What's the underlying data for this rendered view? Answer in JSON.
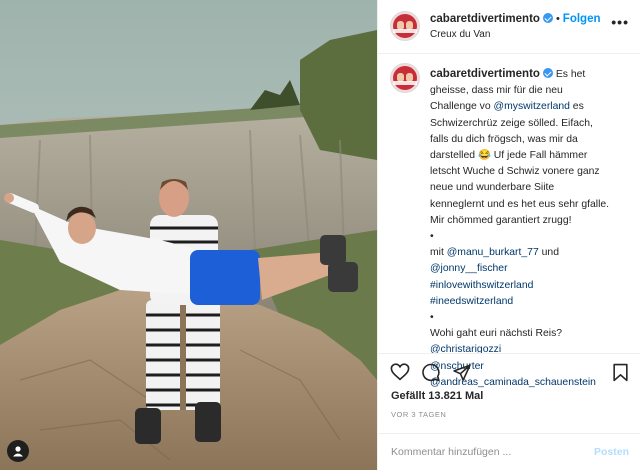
{
  "post": {
    "username": "cabaretdivertimento",
    "separator": "•",
    "follow_label": "Folgen",
    "location": "Creux du Van",
    "more_label": "•••"
  },
  "caption": {
    "username": "cabaretdivertimento",
    "lines": [
      {
        "pre": "Es het",
        "tag": "",
        "post": ""
      },
      {
        "pre": "gheisse, dass mir für die neu",
        "tag": "",
        "post": ""
      },
      {
        "pre": "Challenge vo ",
        "tag": "@myswitzerland",
        "post": " es"
      },
      {
        "pre": "Schwizerchrüz zeige sölled. Eifach,",
        "tag": "",
        "post": ""
      },
      {
        "pre": "falls du dich frögsch, was mir da",
        "tag": "",
        "post": ""
      },
      {
        "pre": "darstelled 😂 Uf jede Fall hämmer",
        "tag": "",
        "post": ""
      },
      {
        "pre": "letscht Wuche d Schwiz vonere ganz",
        "tag": "",
        "post": ""
      },
      {
        "pre": "neue und wunderbare Siite",
        "tag": "",
        "post": ""
      },
      {
        "pre": "kenneglernt und es het eus sehr gfalle.",
        "tag": "",
        "post": ""
      },
      {
        "pre": "Mir chömmed garantiert zrugg!",
        "tag": "",
        "post": ""
      },
      {
        "pre": "•",
        "tag": "",
        "post": ""
      },
      {
        "pre": "mit ",
        "tag": "@manu_burkart_77",
        "post": " und"
      },
      {
        "pre": "",
        "tag": "@jonny__fischer",
        "post": ""
      },
      {
        "pre": "",
        "tag": "#inlovewithswitzerland",
        "post": ""
      },
      {
        "pre": "",
        "tag": "#ineedswitzerland",
        "post": ""
      },
      {
        "pre": "•",
        "tag": "",
        "post": ""
      },
      {
        "pre": "Wohi gaht euri nächsti Reis?",
        "tag": "",
        "post": ""
      },
      {
        "pre": "",
        "tag": "@christarigozzi",
        "post": ""
      },
      {
        "pre": "",
        "tag": "@nschurter",
        "post": ""
      },
      {
        "pre": "",
        "tag": "@andreas_caminada_schauenstein",
        "post": ""
      }
    ]
  },
  "actions": {
    "like_icon": "heart-icon",
    "comment_icon": "comment-icon",
    "share_icon": "share-icon",
    "save_icon": "bookmark-icon",
    "likes": "Gefällt 13.821 Mal",
    "time": "VOR 3 TAGEN"
  },
  "comment": {
    "placeholder": "Kommentar hinzufügen ...",
    "post_label": "Posten"
  },
  "colors": {
    "link": "#00376b",
    "follow": "#0095f6",
    "verified": "#3897f0",
    "muted": "#8e8e8e"
  }
}
